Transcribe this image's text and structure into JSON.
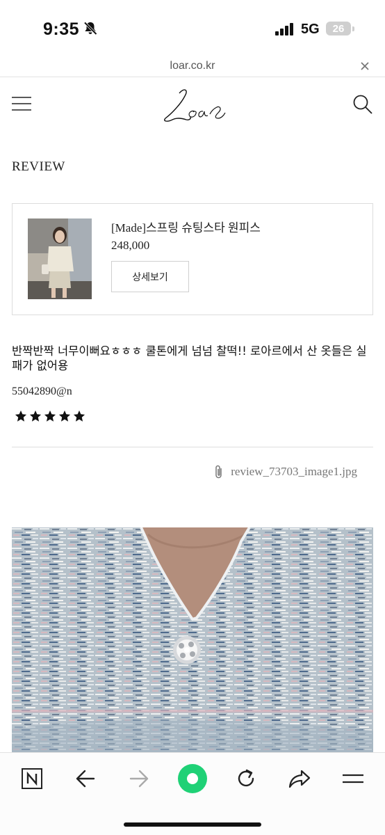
{
  "status_bar": {
    "time": "9:35",
    "network": "5G",
    "battery": "26"
  },
  "browser": {
    "url": "loar.co.kr"
  },
  "site": {
    "logo_text": "Loar"
  },
  "page": {
    "title": "REVIEW"
  },
  "product": {
    "name": "[Made]스프링 슈팅스타 원피스",
    "price": "248,000",
    "detail_button": "상세보기"
  },
  "review": {
    "text": "반짝반짝 너무이뻐요ㅎㅎㅎ 쿨톤에게 넘넘 찰떡!! 로아르에서 산 옷들은 실패가 없어용",
    "author": "55042890@n",
    "rating": 5,
    "attachment": "review_73703_image1.jpg"
  },
  "colors": {
    "accent_green": "#1fd176",
    "text": "#111111",
    "muted": "#777777"
  },
  "icons": [
    "bell-slash-icon",
    "signal-icon",
    "close-icon",
    "menu-icon",
    "search-icon",
    "star-icon",
    "paperclip-icon",
    "naver-n-icon",
    "back-arrow-icon",
    "forward-arrow-icon",
    "green-home-icon",
    "refresh-icon",
    "share-icon",
    "menu-lines-icon"
  ]
}
